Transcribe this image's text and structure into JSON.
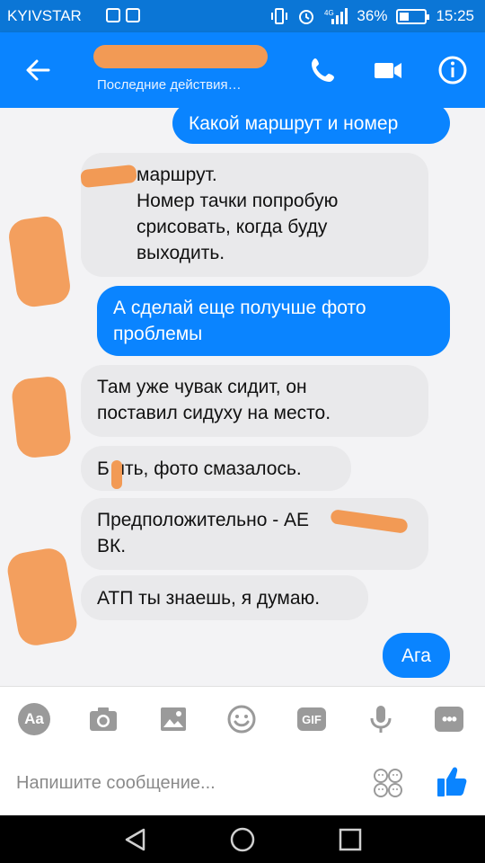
{
  "status_bar": {
    "carrier": "KYIVSTAR",
    "battery": "36%",
    "time": "15:25"
  },
  "header": {
    "subtitle": "Последние действия…"
  },
  "messages": [
    {
      "direction": "out",
      "text": "Какой маршрут и номер"
    },
    {
      "direction": "in",
      "text": "маршрут.\nНомер тачки попробую\nсрисовать, когда буду\nвыходить."
    },
    {
      "direction": "out",
      "text": "А сделай еще получше фото\nпроблемы"
    },
    {
      "direction": "in",
      "text": "Там уже чувак сидит, он\nпоставил сидуху на место."
    },
    {
      "direction": "in",
      "text": "Б  ять, фото смазалось."
    },
    {
      "direction": "in",
      "text": "Предположительно - АЕ\nВК."
    },
    {
      "direction": "in",
      "text": "АТП ты знаешь, я думаю."
    },
    {
      "direction": "out",
      "text": "Ага"
    }
  ],
  "composer": {
    "aa_label": "Aa",
    "gif_label": "GIF",
    "more_label": "•••",
    "placeholder": "Напишите сообщение..."
  },
  "colors": {
    "brand": "#0a84ff",
    "status_bar": "#0b76d6",
    "incoming_bubble": "#e9e9eb",
    "redaction": "#f29a55"
  },
  "icons": [
    "back-arrow-icon",
    "phone-icon",
    "video-camera-icon",
    "info-icon",
    "camera-icon",
    "image-icon",
    "emoji-icon",
    "microphone-icon",
    "stickers-icon",
    "thumbs-up-icon",
    "nav-back-icon",
    "nav-home-icon",
    "nav-recents-icon"
  ]
}
